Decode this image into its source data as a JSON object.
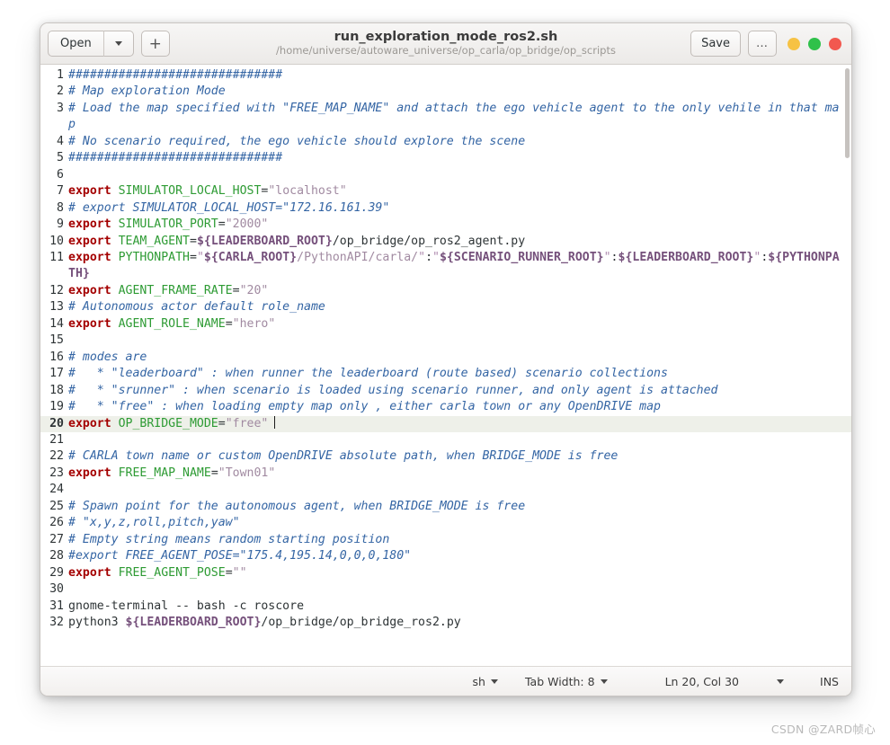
{
  "window": {
    "title": "run_exploration_mode_ros2.sh",
    "subtitle": "/home/universe/autoware_universe/op_carla/op_bridge/op_scripts"
  },
  "toolbar": {
    "open_label": "Open",
    "open_dropdown_icon": "chevron-down-icon",
    "new_tab_label": "+",
    "save_label": "Save",
    "menu_label": "…",
    "window_buttons": [
      {
        "name": "minimize",
        "color": "#f6c244"
      },
      {
        "name": "maximize",
        "color": "#2fc14a"
      },
      {
        "name": "close",
        "color": "#f2584f"
      }
    ]
  },
  "statusbar": {
    "language": "sh",
    "tab_width": "Tab Width: 8",
    "position": "Ln 20, Col 30",
    "insert_mode": "INS",
    "dropdown_icon": "chevron-down-icon"
  },
  "watermark": "CSDN @ZARD帧心",
  "editor": {
    "cursor_line": 20,
    "cursor_col": 30,
    "colors": {
      "comment": "#3465a4",
      "keyword": "#a40000",
      "variable": "#2e9b34",
      "string": "#a18aa1",
      "expansion": "#75507b",
      "plain": "#2e3436",
      "current_line_bg": "#eef0e9"
    },
    "lines": [
      {
        "n": 1,
        "tokens": [
          {
            "c": "cm",
            "t": "##############################"
          }
        ]
      },
      {
        "n": 2,
        "tokens": [
          {
            "c": "cm",
            "t": "# Map exploration Mode"
          }
        ]
      },
      {
        "n": 3,
        "tokens": [
          {
            "c": "cm",
            "t": "# Load the map specified with \"FREE_MAP_NAME\" and attach the ego vehicle agent to the only vehile in that map"
          }
        ]
      },
      {
        "n": 4,
        "tokens": [
          {
            "c": "cm",
            "t": "# No scenario required, the ego vehicle should explore the scene"
          }
        ]
      },
      {
        "n": 5,
        "tokens": [
          {
            "c": "cm",
            "t": "##############################"
          }
        ]
      },
      {
        "n": 6,
        "tokens": []
      },
      {
        "n": 7,
        "tokens": [
          {
            "c": "kw",
            "t": "export"
          },
          {
            "c": "pl",
            "t": " "
          },
          {
            "c": "vr",
            "t": "SIMULATOR_LOCAL_HOST"
          },
          {
            "c": "pl",
            "t": "="
          },
          {
            "c": "st",
            "t": "\"localhost\""
          }
        ]
      },
      {
        "n": 8,
        "tokens": [
          {
            "c": "cm",
            "t": "# export SIMULATOR_LOCAL_HOST=\"172.16.161.39\""
          }
        ]
      },
      {
        "n": 9,
        "tokens": [
          {
            "c": "kw",
            "t": "export"
          },
          {
            "c": "pl",
            "t": " "
          },
          {
            "c": "vr",
            "t": "SIMULATOR_PORT"
          },
          {
            "c": "pl",
            "t": "="
          },
          {
            "c": "st",
            "t": "\"2000\""
          }
        ]
      },
      {
        "n": 10,
        "tokens": [
          {
            "c": "kw",
            "t": "export"
          },
          {
            "c": "pl",
            "t": " "
          },
          {
            "c": "vr",
            "t": "TEAM_AGENT"
          },
          {
            "c": "pl",
            "t": "="
          },
          {
            "c": "vx",
            "t": "${LEADERBOARD_ROOT}"
          },
          {
            "c": "pl",
            "t": "/op_bridge/op_ros2_agent.py"
          }
        ]
      },
      {
        "n": 11,
        "tokens": [
          {
            "c": "kw",
            "t": "export"
          },
          {
            "c": "pl",
            "t": " "
          },
          {
            "c": "vr",
            "t": "PYTHONPATH"
          },
          {
            "c": "pl",
            "t": "="
          },
          {
            "c": "dl",
            "t": "\""
          },
          {
            "c": "vx",
            "t": "${CARLA_ROOT}"
          },
          {
            "c": "st",
            "t": "/PythonAPI/carla/"
          },
          {
            "c": "dl",
            "t": "\""
          },
          {
            "c": "pl",
            "t": ":"
          },
          {
            "c": "dl",
            "t": "\""
          },
          {
            "c": "vx",
            "t": "${SCENARIO_RUNNER_ROOT}"
          },
          {
            "c": "dl",
            "t": "\""
          },
          {
            "c": "pl",
            "t": ":"
          },
          {
            "c": "vx",
            "t": "${LEADERBOARD_ROOT}"
          },
          {
            "c": "dl",
            "t": "\""
          },
          {
            "c": "pl",
            "t": ":"
          },
          {
            "c": "vx",
            "t": "${PYTHONPATH}"
          }
        ]
      },
      {
        "n": 12,
        "tokens": [
          {
            "c": "kw",
            "t": "export"
          },
          {
            "c": "pl",
            "t": " "
          },
          {
            "c": "vr",
            "t": "AGENT_FRAME_RATE"
          },
          {
            "c": "pl",
            "t": "="
          },
          {
            "c": "st",
            "t": "\"20\""
          }
        ]
      },
      {
        "n": 13,
        "tokens": [
          {
            "c": "cm",
            "t": "# Autonomous actor default role_name"
          }
        ]
      },
      {
        "n": 14,
        "tokens": [
          {
            "c": "kw",
            "t": "export"
          },
          {
            "c": "pl",
            "t": " "
          },
          {
            "c": "vr",
            "t": "AGENT_ROLE_NAME"
          },
          {
            "c": "pl",
            "t": "="
          },
          {
            "c": "st",
            "t": "\"hero\""
          }
        ]
      },
      {
        "n": 15,
        "tokens": []
      },
      {
        "n": 16,
        "tokens": [
          {
            "c": "cm",
            "t": "# modes are"
          }
        ]
      },
      {
        "n": 17,
        "tokens": [
          {
            "c": "cm",
            "t": "#   * \"leaderboard\" : when runner the leaderboard (route based) scenario collections"
          }
        ]
      },
      {
        "n": 18,
        "tokens": [
          {
            "c": "cm",
            "t": "#   * \"srunner\" : when scenario is loaded using scenario runner, and only agent is attached"
          }
        ]
      },
      {
        "n": 19,
        "tokens": [
          {
            "c": "cm",
            "t": "#   * \"free\" : when loading empty map only , either carla town or any OpenDRIVE map"
          }
        ]
      },
      {
        "n": 20,
        "current": true,
        "cursor": true,
        "tokens": [
          {
            "c": "kw",
            "t": "export"
          },
          {
            "c": "pl",
            "t": " "
          },
          {
            "c": "vr",
            "t": "OP_BRIDGE_MODE"
          },
          {
            "c": "pl",
            "t": "="
          },
          {
            "c": "st",
            "t": "\"free\""
          }
        ]
      },
      {
        "n": 21,
        "tokens": []
      },
      {
        "n": 22,
        "tokens": [
          {
            "c": "cm",
            "t": "# CARLA town name or custom OpenDRIVE absolute path, when BRIDGE_MODE is free"
          }
        ]
      },
      {
        "n": 23,
        "tokens": [
          {
            "c": "kw",
            "t": "export"
          },
          {
            "c": "pl",
            "t": " "
          },
          {
            "c": "vr",
            "t": "FREE_MAP_NAME"
          },
          {
            "c": "pl",
            "t": "="
          },
          {
            "c": "st",
            "t": "\"Town01\""
          }
        ]
      },
      {
        "n": 24,
        "tokens": []
      },
      {
        "n": 25,
        "tokens": [
          {
            "c": "cm",
            "t": "# Spawn point for the autonomous agent, when BRIDGE_MODE is free"
          }
        ]
      },
      {
        "n": 26,
        "tokens": [
          {
            "c": "cm",
            "t": "# \"x,y,z,roll,pitch,yaw\""
          }
        ]
      },
      {
        "n": 27,
        "tokens": [
          {
            "c": "cm",
            "t": "# Empty string means random starting position"
          }
        ]
      },
      {
        "n": 28,
        "tokens": [
          {
            "c": "cm",
            "t": "#export FREE_AGENT_POSE=\"175.4,195.14,0,0,0,180\""
          }
        ]
      },
      {
        "n": 29,
        "tokens": [
          {
            "c": "kw",
            "t": "export"
          },
          {
            "c": "pl",
            "t": " "
          },
          {
            "c": "vr",
            "t": "FREE_AGENT_POSE"
          },
          {
            "c": "pl",
            "t": "="
          },
          {
            "c": "st",
            "t": "\"\""
          }
        ]
      },
      {
        "n": 30,
        "tokens": []
      },
      {
        "n": 31,
        "tokens": [
          {
            "c": "pl",
            "t": "gnome-terminal -- bash -c roscore"
          }
        ]
      },
      {
        "n": 32,
        "tokens": [
          {
            "c": "pl",
            "t": "python3 "
          },
          {
            "c": "vx",
            "t": "${LEADERBOARD_ROOT}"
          },
          {
            "c": "pl",
            "t": "/op_bridge/op_bridge_ros2.py"
          }
        ]
      }
    ]
  }
}
